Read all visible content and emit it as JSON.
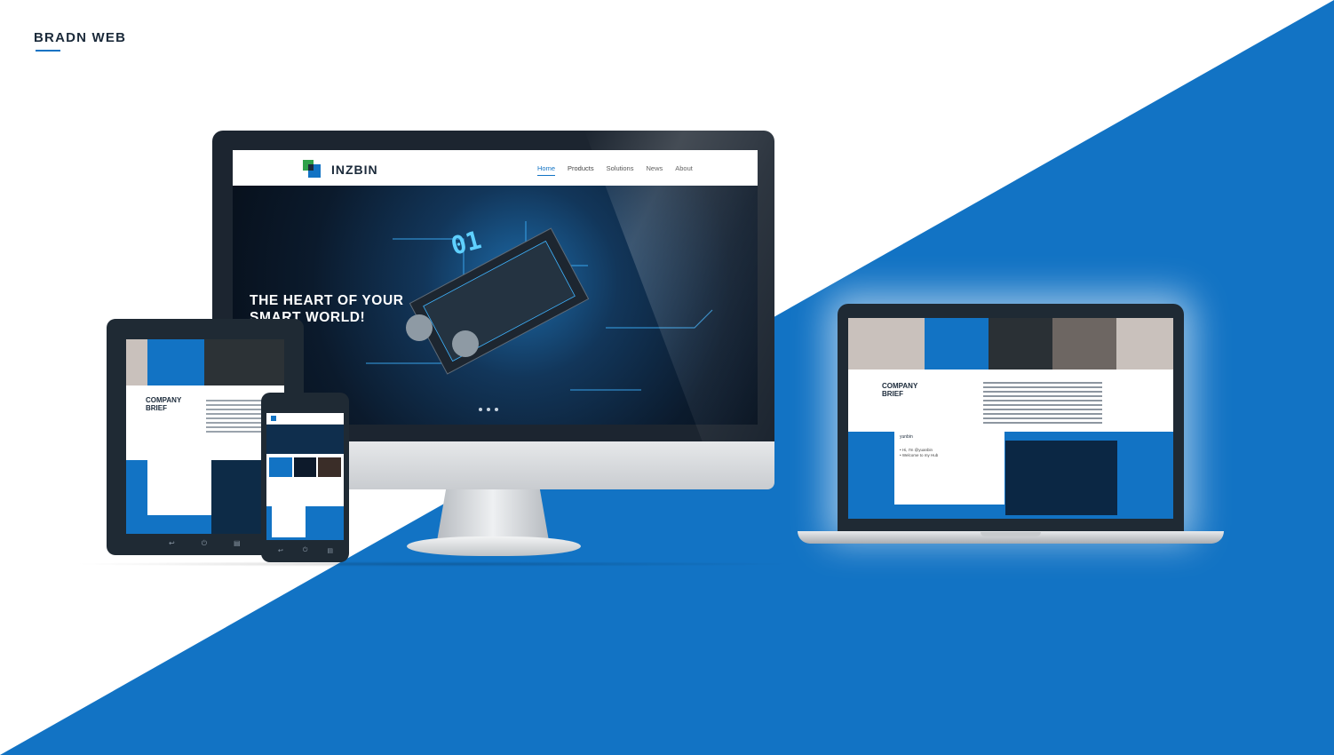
{
  "brand": {
    "title": "BRADN WEB",
    "accent": "#1273c4"
  },
  "desktop": {
    "logo_text": "INZBIN",
    "nav": [
      "Home",
      "Products",
      "Solutions",
      "News",
      "About"
    ],
    "active_nav": "Home",
    "hero_line1": "THE HEART OF YOUR",
    "hero_line2": "SMART WORLD!",
    "carousel_dots": 3
  },
  "tablet": {
    "company_line1": "COMPANY",
    "company_line2": "BRIEF",
    "buttons": [
      "back-icon",
      "power-icon",
      "menu-icon"
    ]
  },
  "laptop": {
    "company_line1": "COMPANY",
    "company_line2": "BRIEF",
    "white_title": "yunbin",
    "white_text_line1": "• Hi, I'm @yuanbin",
    "white_text_line2": "• Welcome to my Hub"
  },
  "colors": {
    "blue": "#1273c4",
    "dark": "#1f2a34",
    "screen_dark": "#0d1a2b"
  }
}
